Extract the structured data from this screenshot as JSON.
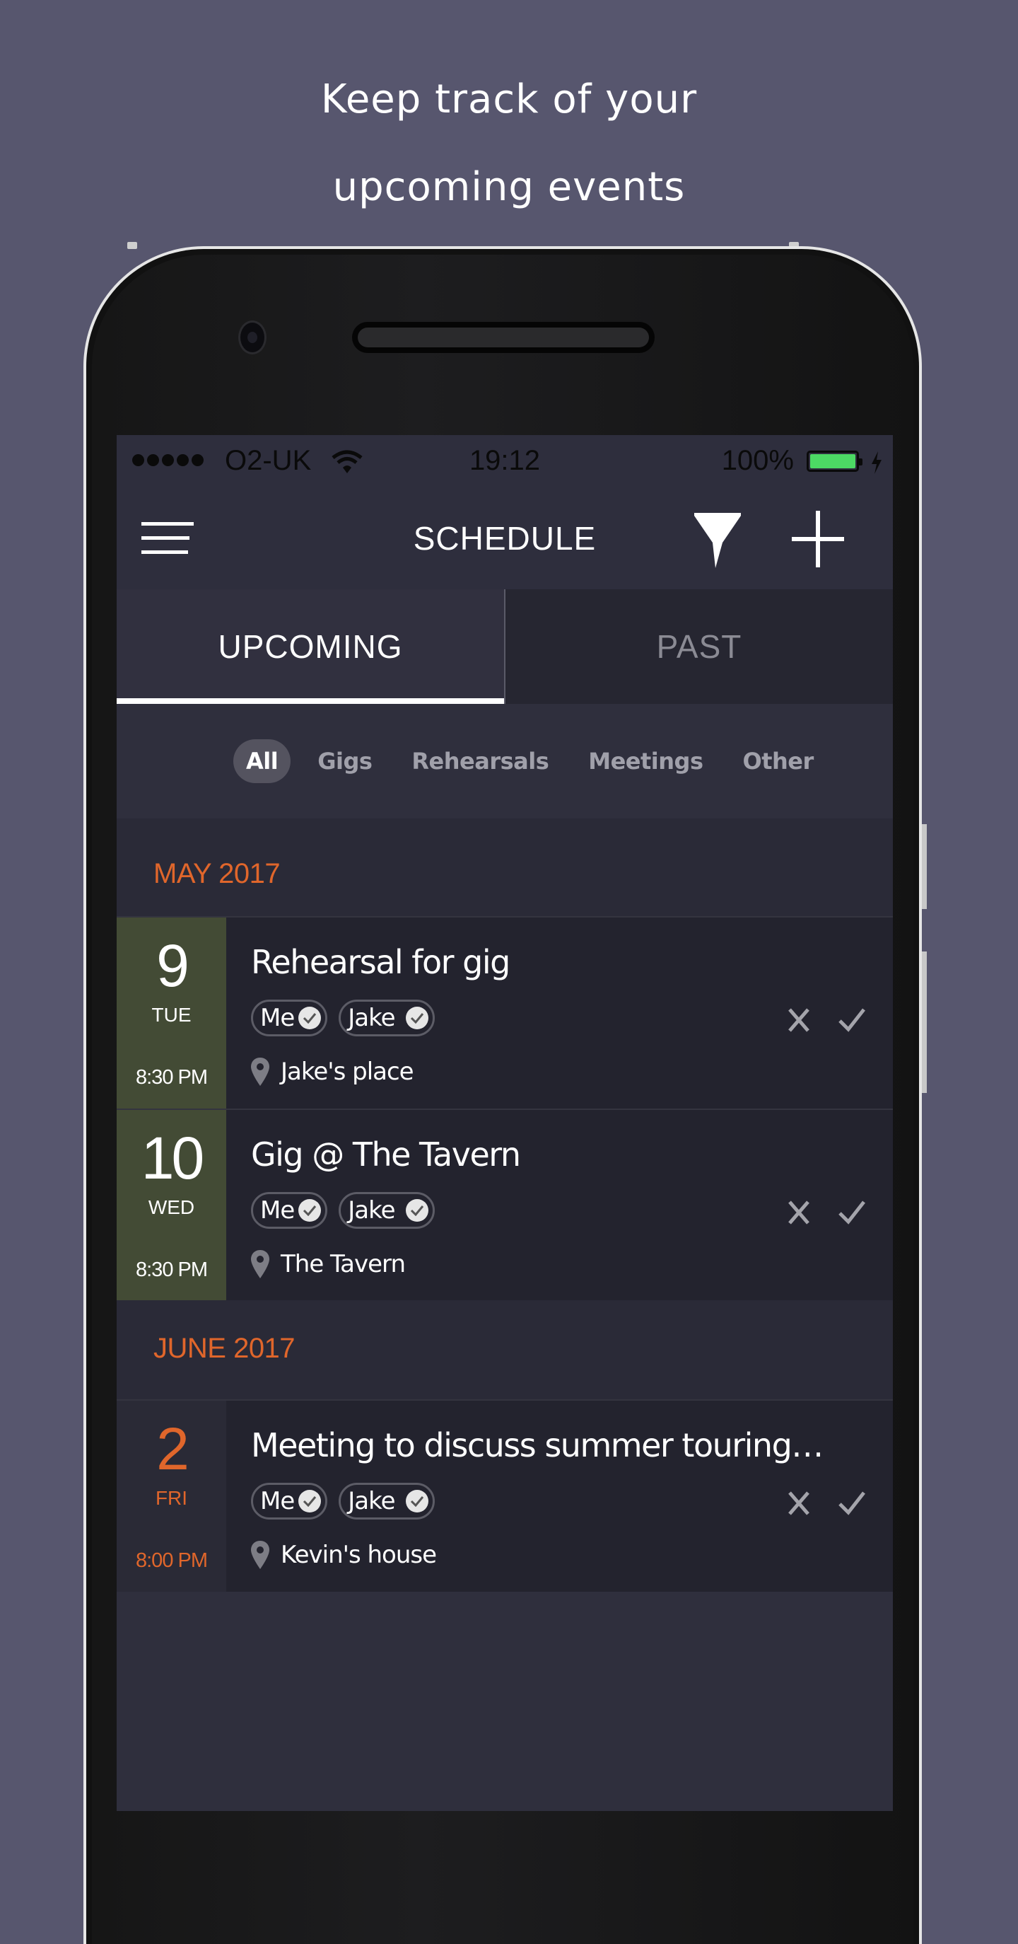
{
  "promo": {
    "line1": "Keep track of your",
    "line2": "upcoming events"
  },
  "status_bar": {
    "carrier": "O2-UK",
    "time": "19:12",
    "battery_percent": "100%",
    "battery_level": 1.0,
    "signal_bars": 5
  },
  "navbar": {
    "title": "SCHEDULE",
    "menu_icon": "hamburger-menu-icon",
    "filter_icon": "filter-funnel-icon",
    "add_icon": "plus-icon"
  },
  "tabs": [
    {
      "label": "UPCOMING",
      "active": true
    },
    {
      "label": "PAST",
      "active": false
    }
  ],
  "filters": [
    {
      "label": "All",
      "active": true
    },
    {
      "label": "Gigs",
      "active": false
    },
    {
      "label": "Rehearsals",
      "active": false
    },
    {
      "label": "Meetings",
      "active": false
    },
    {
      "label": "Other",
      "active": false
    }
  ],
  "groups": [
    {
      "month": "MAY 2017",
      "events": [
        {
          "day": "9",
          "weekday": "TUE",
          "time": "8:30 PM",
          "title": "Rehearsal for gig",
          "attendees": [
            "Me",
            "Jake"
          ],
          "location": "Jake's place"
        },
        {
          "day": "10",
          "weekday": "WED",
          "time": "8:30 PM",
          "title": "Gig @ The Tavern",
          "attendees": [
            "Me",
            "Jake"
          ],
          "location": "The Tavern"
        }
      ]
    },
    {
      "month": "JUNE 2017",
      "events": [
        {
          "day": "2",
          "weekday": "FRI",
          "time": "8:00 PM",
          "title": "Meeting to discuss summer touring…",
          "attendees": [
            "Me",
            "Jake"
          ],
          "location": "Kevin's house"
        }
      ]
    }
  ],
  "colors": {
    "background": "#57566e",
    "accent_orange": "#e0662b",
    "date_green": "#434b35",
    "battery_green": "#4cd964"
  }
}
